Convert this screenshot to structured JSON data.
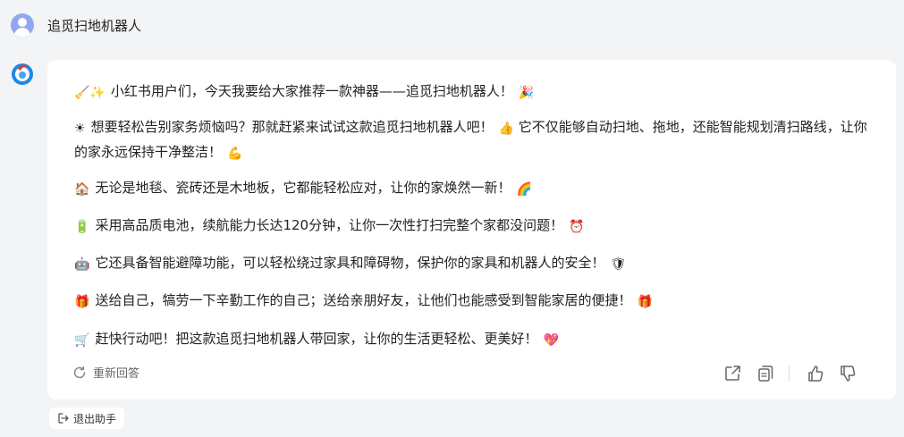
{
  "conversation": {
    "user_query": "追觅扫地机器人"
  },
  "answer": {
    "paragraphs": [
      {
        "icon": "broom-sparkles-icon",
        "glyph": "🧹✨",
        "text": "小红书用户们，今天我要给大家推荐一款神器——追觅扫地机器人！",
        "end_glyph": "🎉",
        "end_icon": "party-popper-icon"
      },
      {
        "icon": "sun-icon",
        "glyph": "☀",
        "text": "想要轻松告别家务烦恼吗？那就赶紧来试试这款追觅扫地机器人吧！",
        "mid_glyph": "👍",
        "mid_icon": "thumbs-up-emoji-icon",
        "text2": "它不仅能够自动扫地、拖地，还能智能规划清扫路线，让你的家永远保持干净整洁！",
        "end_glyph": "💪",
        "end_icon": "flexed-arm-icon"
      },
      {
        "icon": "house-icon",
        "glyph": "🏠",
        "text": "无论是地毯、瓷砖还是木地板，它都能轻松应对，让你的家焕然一新！",
        "end_glyph": "🌈",
        "end_icon": "rainbow-icon"
      },
      {
        "icon": "battery-icon",
        "glyph": "🔋",
        "text": "采用高品质电池，续航能力长达120分钟，让你一次性打扫完整个家都没问题！",
        "end_glyph": "⏰",
        "end_icon": "alarm-clock-icon"
      },
      {
        "icon": "robot-icon",
        "glyph": "🤖",
        "text": "它还具备智能避障功能，可以轻松绕过家具和障碍物，保护你的家具和机器人的安全！",
        "end_glyph": "🛡",
        "end_icon": "shield-icon"
      },
      {
        "icon": "gift-icon",
        "glyph": "🎁",
        "text": "送给自己，犒劳一下辛勤工作的自己；送给亲朋好友，让他们也能感受到智能家居的便捷！",
        "end_glyph": "🎁",
        "end_icon": "gift-icon"
      },
      {
        "icon": "shopping-cart-icon",
        "glyph": "🛒",
        "text": "赶快行动吧！把这款追觅扫地机器人带回家，让你的生活更轻松、更美好！",
        "end_glyph": "💖",
        "end_icon": "sparkling-heart-icon"
      }
    ],
    "regenerate_label": "重新回答"
  },
  "footer": {
    "exit_label": "退出助手"
  },
  "colors": {
    "background": "#f3f4f6",
    "card": "#ffffff",
    "text": "#222222",
    "muted": "#666666"
  }
}
